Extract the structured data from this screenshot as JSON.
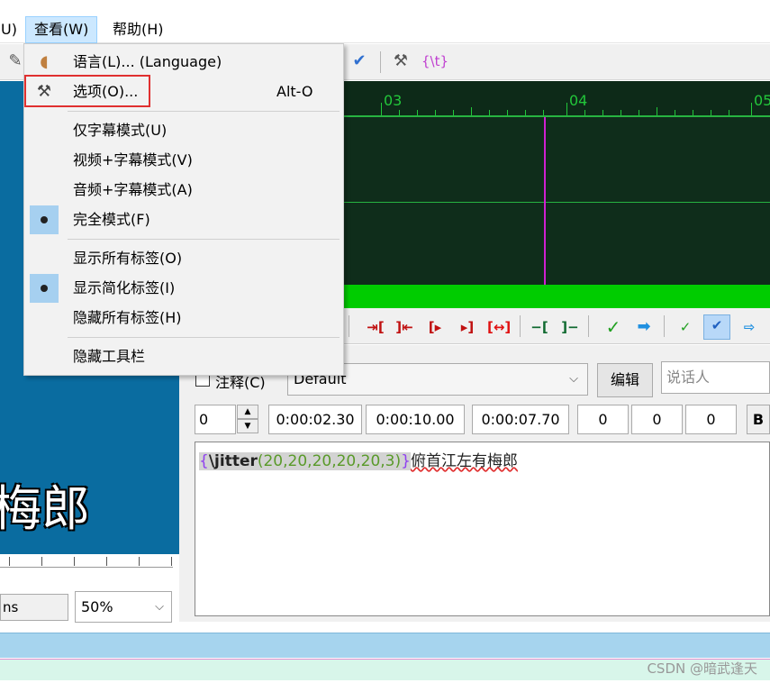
{
  "menubar": {
    "items": [
      "U)",
      "查看(W)",
      "帮助(H)"
    ],
    "active_index": 1
  },
  "view_menu": {
    "items": [
      {
        "label": "语言(L)... (Language)",
        "icon": "language-icon",
        "checked": false
      },
      {
        "label": "选项(O)...",
        "shortcut": "Alt-O",
        "icon": "hammer-icon",
        "checked": false
      },
      {
        "label": "仅字幕模式(U)",
        "checked": false
      },
      {
        "label": "视频+字幕模式(V)",
        "checked": false
      },
      {
        "label": "音频+字幕模式(A)",
        "checked": false
      },
      {
        "label": "完全模式(F)",
        "checked": true
      },
      {
        "label": "显示所有标签(O)",
        "checked": false
      },
      {
        "label": "显示简化标签(I)",
        "checked": true
      },
      {
        "label": "隐藏所有标签(H)",
        "checked": false
      },
      {
        "label": "隐藏工具栏",
        "checked": false
      }
    ]
  },
  "toolbar": {
    "tag_button": "{\\t}",
    "icons": [
      "pen-icon",
      "spellcheck-icon",
      "hammer-icon",
      "transform-tag-icon"
    ]
  },
  "audio": {
    "ruler_labels": [
      "03",
      "04",
      "05"
    ]
  },
  "video": {
    "subtitle_preview": "梅郎",
    "ms_field": "ns",
    "zoom": "50%"
  },
  "edit": {
    "comment_label": "注释(C)",
    "style": "Default",
    "edit_button": "编辑",
    "speaker_placeholder": "说话人",
    "layer": "0",
    "start_time": "0:00:02.30",
    "end_time": "0:00:10.00",
    "duration": "0:00:07.70",
    "margin_l": "0",
    "margin_r": "0",
    "margin_v": "0",
    "bold_button": "B",
    "text": {
      "open": "{",
      "cmd": "\\jitter",
      "args": "(20,20,20,20,20,3)",
      "close": "}",
      "body": "俯首江左有梅郎"
    }
  },
  "watermark": "CSDN @暗武逢天",
  "colors": {
    "video_bg": "#0a6ca0",
    "audio_bg": "#0f2d1b",
    "audio_green": "#00cc00",
    "cursor": "#d020d0",
    "highlight": "#e03030"
  }
}
